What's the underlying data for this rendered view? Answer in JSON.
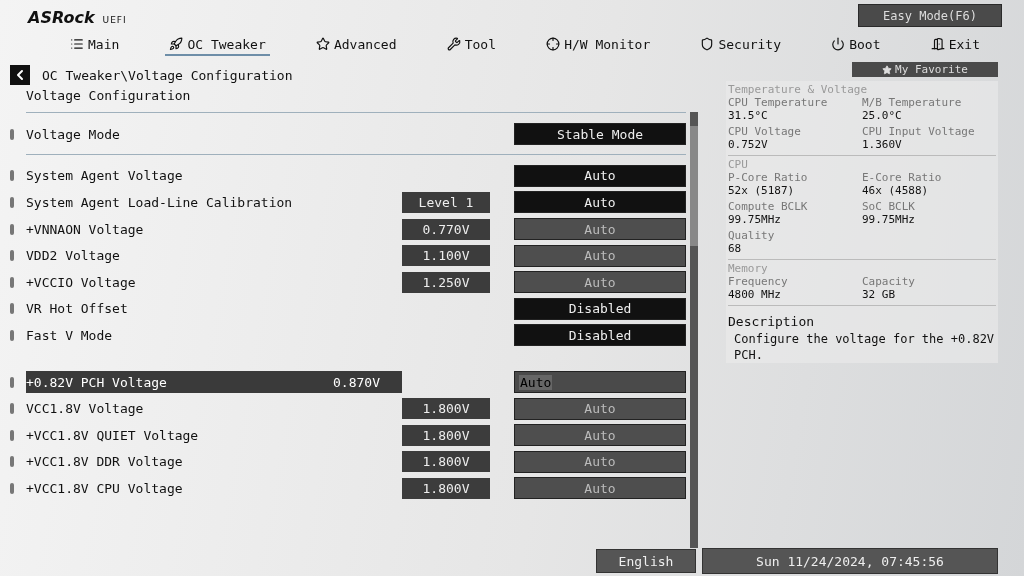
{
  "logo": {
    "brand": "ASRock",
    "product": "UEFI"
  },
  "easy_mode_button": "Easy Mode(F6)",
  "tabs": [
    {
      "label": "Main",
      "selected": false
    },
    {
      "label": "OC Tweaker",
      "selected": true
    },
    {
      "label": "Advanced",
      "selected": false
    },
    {
      "label": "Tool",
      "selected": false
    },
    {
      "label": "H/W Monitor",
      "selected": false
    },
    {
      "label": "Security",
      "selected": false
    },
    {
      "label": "Boot",
      "selected": false
    },
    {
      "label": "Exit",
      "selected": false
    }
  ],
  "breadcrumb": "OC Tweaker\\Voltage Configuration",
  "favorite_button": "My Favorite",
  "page_title": "Voltage Configuration",
  "sections": [
    {
      "divider_after": true,
      "items": [
        {
          "label": "Voltage Mode",
          "option": "Stable Mode",
          "locked": false,
          "selected": false
        }
      ]
    },
    {
      "divider_after": false,
      "items": [
        {
          "label": "System Agent Voltage",
          "option": "Auto",
          "locked": false,
          "selected": false
        },
        {
          "label": "System Agent Load-Line Calibration",
          "value": "Level 1",
          "option": "Auto",
          "locked": false,
          "selected": false
        },
        {
          "label": "+VNNAON Voltage",
          "value": "0.770V",
          "option": "Auto",
          "locked": true,
          "selected": false
        },
        {
          "label": "VDD2 Voltage",
          "value": "1.100V",
          "option": "Auto",
          "locked": true,
          "selected": false
        },
        {
          "label": "+VCCIO Voltage",
          "value": "1.250V",
          "option": "Auto",
          "locked": true,
          "selected": false
        },
        {
          "label": "VR Hot Offset",
          "option": "Disabled",
          "locked": false,
          "selected": false
        },
        {
          "label": "Fast V Mode",
          "option": "Disabled",
          "locked": false,
          "selected": false
        }
      ]
    },
    {
      "divider_after": false,
      "items": [
        {
          "label": "+0.82V PCH Voltage",
          "value": "0.870V",
          "option": "Auto",
          "locked": false,
          "selected": true
        },
        {
          "label": "VCC1.8V Voltage",
          "value": "1.800V",
          "option": "Auto",
          "locked": true,
          "selected": false
        },
        {
          "label": "+VCC1.8V QUIET Voltage",
          "value": "1.800V",
          "option": "Auto",
          "locked": true,
          "selected": false
        },
        {
          "label": "+VCC1.8V DDR Voltage",
          "value": "1.800V",
          "option": "Auto",
          "locked": true,
          "selected": false
        },
        {
          "label": "+VCC1.8V CPU Voltage",
          "value": "1.800V",
          "option": "Auto",
          "locked": true,
          "selected": false
        }
      ]
    }
  ],
  "monitor": [
    {
      "title": "Temperature & Voltage",
      "readings": [
        {
          "name": "CPU Temperature",
          "value": "31.5°C"
        },
        {
          "name": "M/B Temperature",
          "value": "25.0°C"
        },
        {
          "name": "CPU Voltage",
          "value": "0.752V"
        },
        {
          "name": "CPU Input Voltage",
          "value": "1.360V"
        }
      ]
    },
    {
      "title": "CPU",
      "readings": [
        {
          "name": "P-Core Ratio",
          "value": "52x (5187)"
        },
        {
          "name": "E-Core Ratio",
          "value": "46x (4588)"
        },
        {
          "name": "Compute BCLK",
          "value": "99.75MHz"
        },
        {
          "name": "SoC BCLK",
          "value": "99.75MHz"
        },
        {
          "name": "Quality",
          "value": "68"
        }
      ]
    },
    {
      "title": "Memory",
      "readings": [
        {
          "name": "Frequency",
          "value": "4800 MHz"
        },
        {
          "name": "Capacity",
          "value": "32 GB"
        }
      ]
    }
  ],
  "description": {
    "title": "Description",
    "text": "Configure the voltage for the +0.82V PCH."
  },
  "footer": {
    "language": "English",
    "datetime": "Sun 11/24/2024, 07:45:56"
  }
}
